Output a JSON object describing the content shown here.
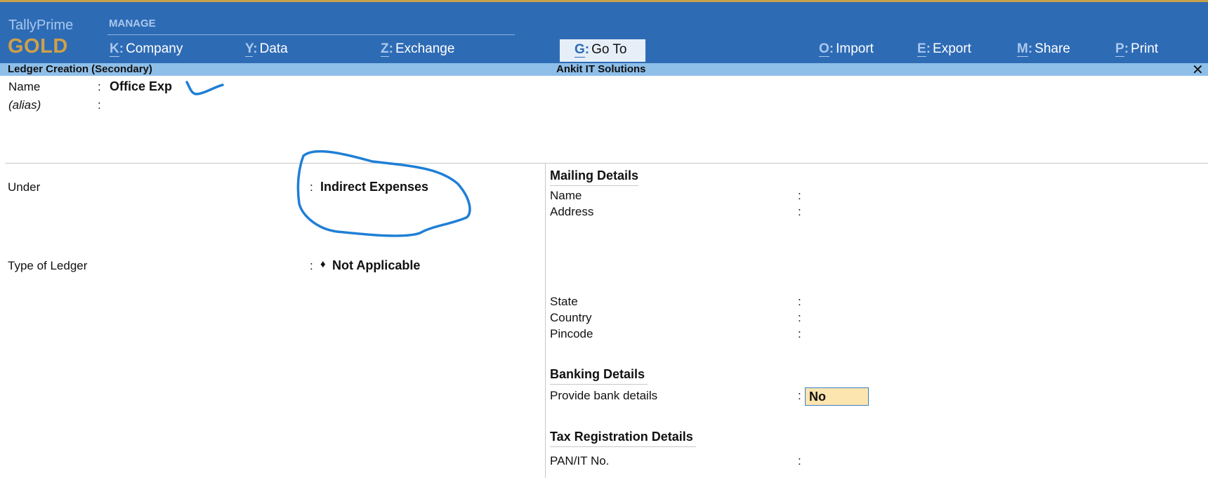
{
  "brand": {
    "name": "TallyPrime",
    "edition": "GOLD"
  },
  "menu": {
    "section_label": "MANAGE",
    "items": [
      {
        "key": "K",
        "label": "Company"
      },
      {
        "key": "Y",
        "label": "Data"
      },
      {
        "key": "Z",
        "label": "Exchange"
      },
      {
        "key": "G",
        "label": "Go To"
      },
      {
        "key": "O",
        "label": "Import"
      },
      {
        "key": "E",
        "label": "Export"
      },
      {
        "key": "M",
        "label": "Share"
      },
      {
        "key": "P",
        "label": "Print"
      }
    ]
  },
  "titlebar": {
    "form_title": "Ledger Creation (Secondary)",
    "company": "Ankit IT Solutions",
    "close_symbol": "✕"
  },
  "form": {
    "name": {
      "label": "Name",
      "colon": ":",
      "value": "Office Exp"
    },
    "alias": {
      "label": "(alias)",
      "colon": ":",
      "value": ""
    },
    "under": {
      "label": "Under",
      "colon": ":",
      "value": "Indirect Expenses"
    },
    "type_of_ledger": {
      "label": "Type of Ledger",
      "colon": ":",
      "bullet": "♦",
      "value": "Not Applicable"
    }
  },
  "mailing": {
    "heading": "Mailing Details",
    "fields": [
      {
        "label": "Name",
        "colon": ":"
      },
      {
        "label": "Address",
        "colon": ":"
      },
      {
        "label": "State",
        "colon": ":"
      },
      {
        "label": "Country",
        "colon": ":"
      },
      {
        "label": "Pincode",
        "colon": ":"
      }
    ]
  },
  "banking": {
    "heading": "Banking Details",
    "label": "Provide bank details",
    "colon": ":",
    "value": "No"
  },
  "tax": {
    "heading": "Tax Registration Details",
    "label": "PAN/IT No.",
    "colon": ":"
  },
  "colors": {
    "topbar": "#2e6bb5",
    "titlebar": "#8ebfe9",
    "edition": "#cfa048",
    "highlight": "#fde5b0",
    "annotation": "#1f7fd6"
  }
}
